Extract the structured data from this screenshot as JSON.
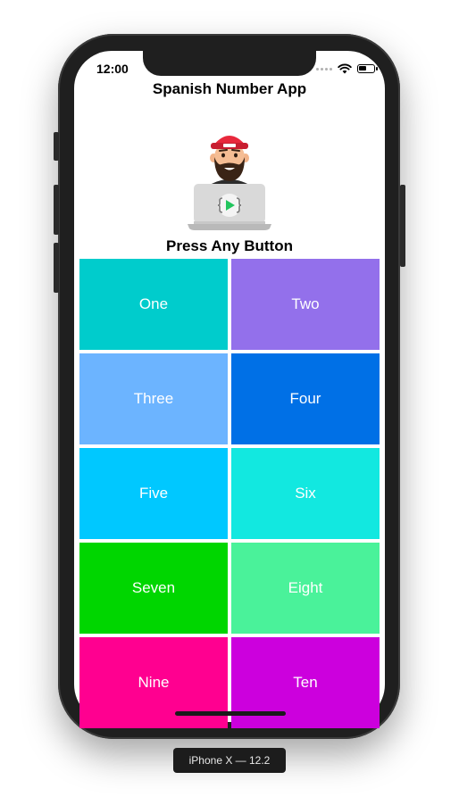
{
  "status_bar": {
    "time": "12:00"
  },
  "app": {
    "title": "Spanish Number App",
    "prompt": "Press Any Button",
    "buttons": [
      {
        "label": "One",
        "color": "#00CCCC"
      },
      {
        "label": "Two",
        "color": "#9370EB"
      },
      {
        "label": "Three",
        "color": "#6CB4FF"
      },
      {
        "label": "Four",
        "color": "#0070E6"
      },
      {
        "label": "Five",
        "color": "#00C8FF"
      },
      {
        "label": "Six",
        "color": "#12E8E0"
      },
      {
        "label": "Seven",
        "color": "#00D600"
      },
      {
        "label": "Eight",
        "color": "#4AF29A"
      },
      {
        "label": "Nine",
        "color": "#FF0090"
      },
      {
        "label": "Ten",
        "color": "#CC00DD"
      }
    ]
  },
  "device": {
    "label": "iPhone X — 12.2"
  },
  "icons": {
    "avatar": "bearded-developer-laptop-icon",
    "wifi": "wifi-icon",
    "battery": "battery-icon",
    "signal": "signal-dots-icon"
  }
}
